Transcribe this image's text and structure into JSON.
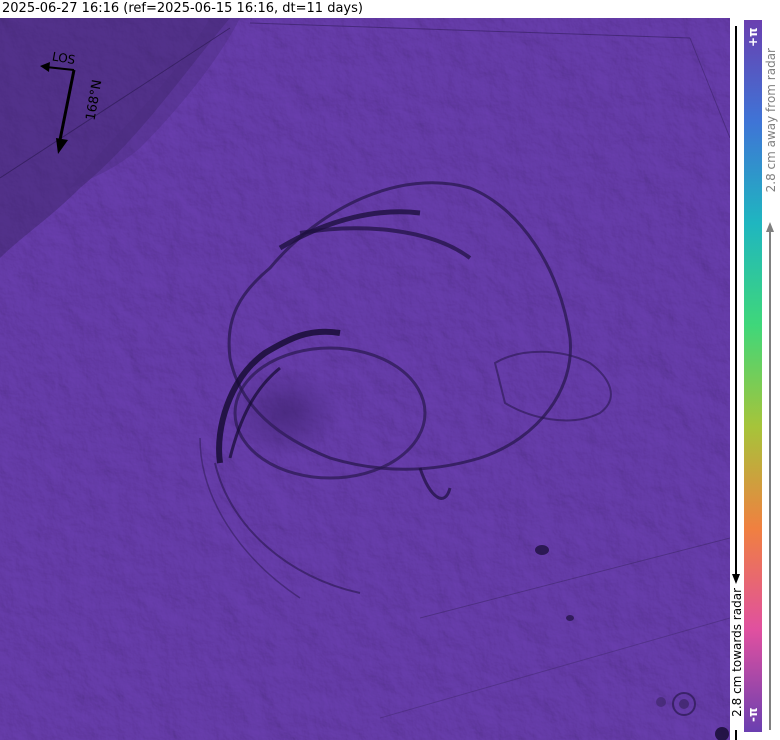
{
  "header": {
    "title": "2025-06-27 16:16 (ref=2025-06-15 16:16, dt=11 days)"
  },
  "map": {
    "compass": {
      "los_label": "LOS",
      "heading_label": "168°N"
    },
    "base_color": "#6a3fb0"
  },
  "colorbar": {
    "top_label": "+π",
    "bottom_label": "-π",
    "away_label": "2.8 cm away from radar",
    "towards_label": "2.8 cm towards radar",
    "colors": [
      "#6a3fb0",
      "#3f74d6",
      "#1fb6c0",
      "#3fd77a",
      "#a6c43a",
      "#f08040",
      "#e050a0",
      "#6a3fb0"
    ]
  }
}
